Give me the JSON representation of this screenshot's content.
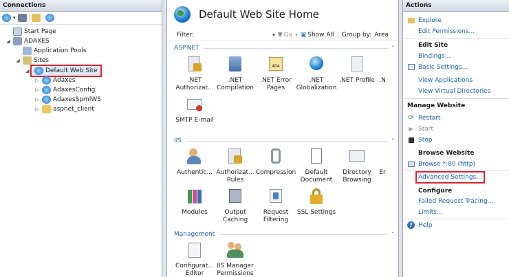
{
  "connections": {
    "title": "Connections",
    "tree": [
      "Start Page",
      "ADAXES",
      "Application Pools",
      "Sites",
      "Default Web Site",
      "Adaxes",
      "AdaxesConfig",
      "AdaxesSpmlWS",
      "aspnet_client"
    ]
  },
  "center": {
    "title": "Default Web Site Home",
    "filter_label": "Filter:",
    "go_label": "Go",
    "show_all_label": "Show All",
    "group_by_label": "Group by:",
    "group_by_value": "Area",
    "sections": {
      "aspnet": "ASP.NET",
      "iis": "IIS",
      "management": "Management"
    },
    "aspnet_features": [
      ".NET Authorizat...",
      ".NET Compilation",
      ".NET Error Pages",
      ".NET Globalization",
      ".NET Profile",
      ".N",
      "SMTP E-mail"
    ],
    "iis_features": [
      "Authentic...",
      "Authorizat... Rules",
      "Compression",
      "Default Document",
      "Directory Browsing",
      "Er",
      "Modules",
      "Output Caching",
      "Request Filtering",
      "SSL Settings"
    ],
    "management_features": [
      "Configurat... Editor",
      "IIS Manager Permissions"
    ]
  },
  "actions": {
    "title": "Actions",
    "explore": "Explore",
    "edit_permissions": "Edit Permissions...",
    "edit_site": "Edit Site",
    "bindings": "Bindings...",
    "basic_settings": "Basic Settings...",
    "view_applications": "View Applications",
    "view_virtual_directories": "View Virtual Directories",
    "manage_website": "Manage Website",
    "restart": "Restart",
    "start": "Start",
    "stop": "Stop",
    "browse_website": "Browse Website",
    "browse_port": "Browse *:80 (http)",
    "advanced_settings": "Advanced Settings...",
    "configure": "Configure",
    "failed_request_tracing": "Failed Request Tracing...",
    "limits": "Limits...",
    "help": "Help"
  }
}
